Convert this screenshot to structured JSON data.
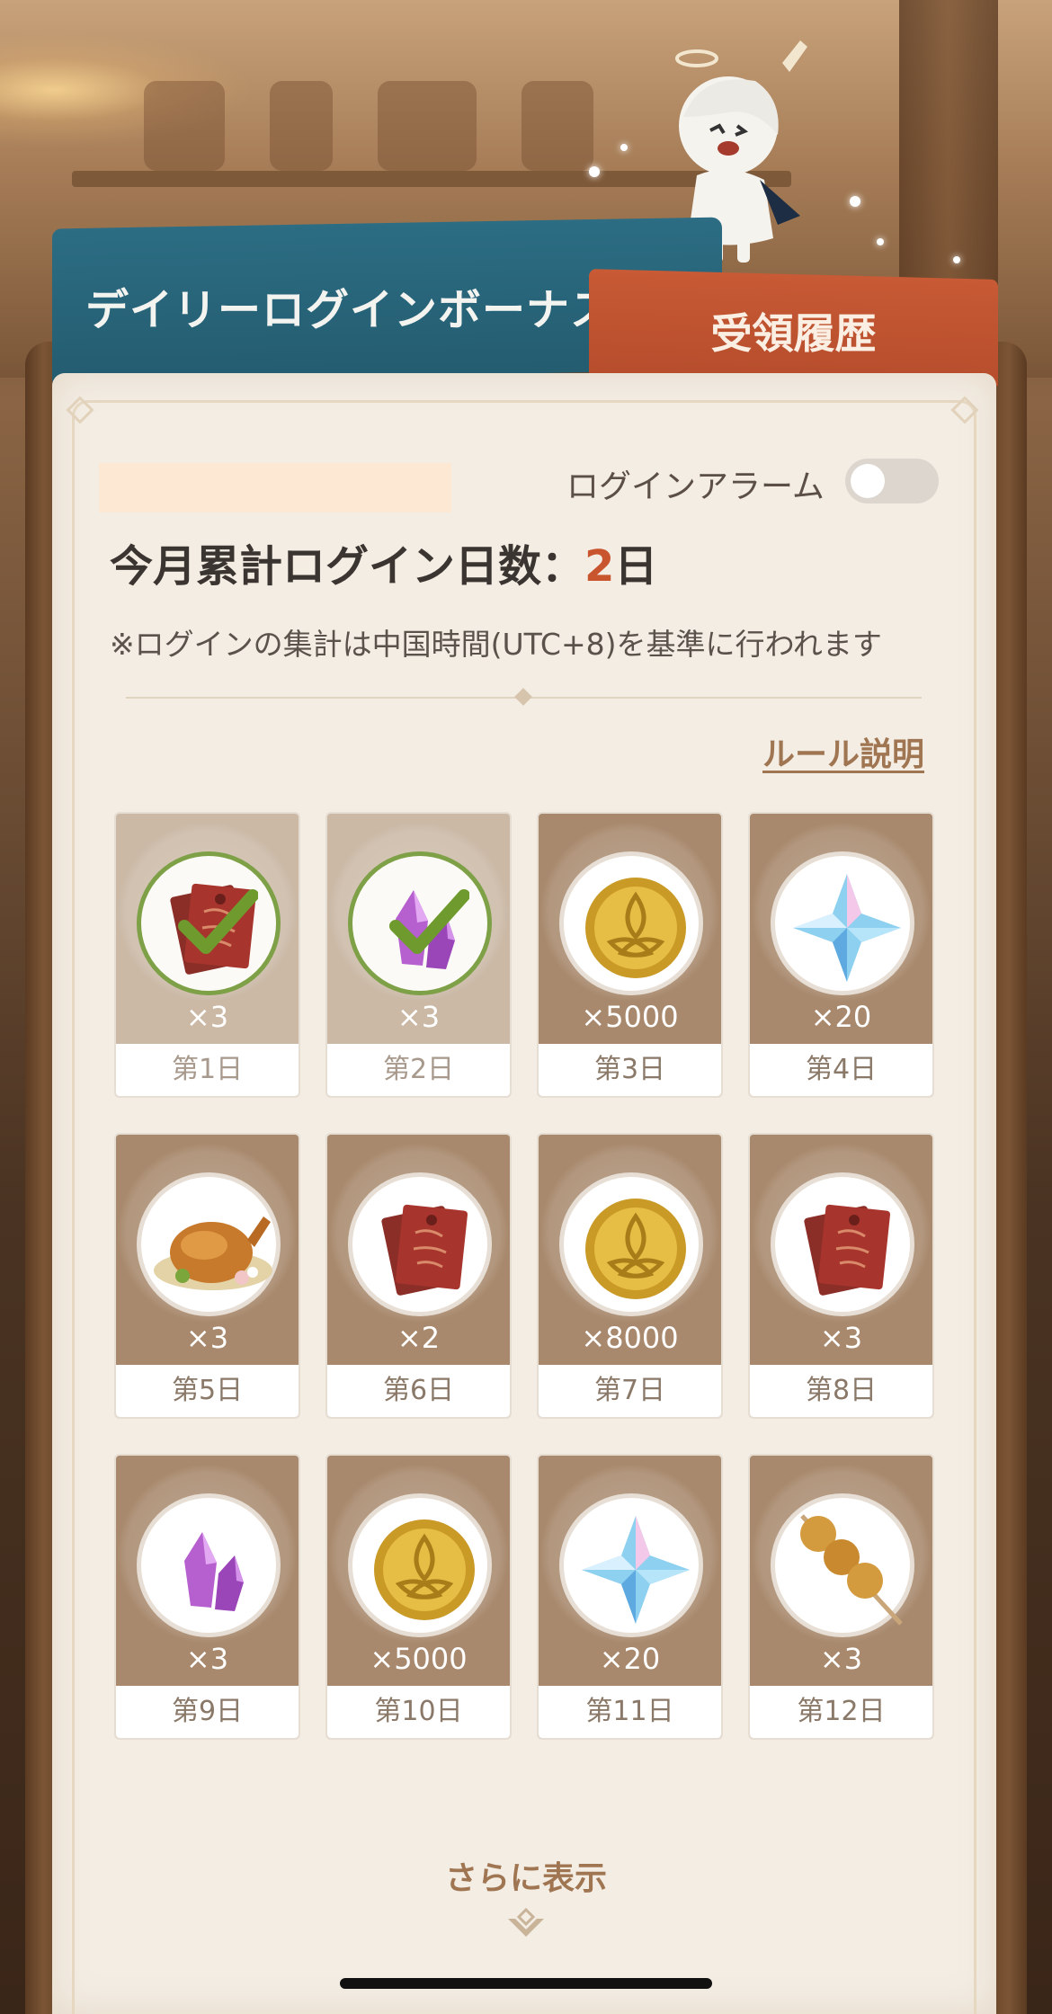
{
  "tabs": {
    "daily_login_bonus": "デイリーログインボーナス",
    "claim_history": "受領履歴"
  },
  "header": {
    "uid": "",
    "alarm_label": "ログインアラーム",
    "alarm_on": false,
    "login_count_prefix": "今月累計ログイン日数：",
    "login_count_value": "2",
    "login_count_suffix": "日",
    "notice": "※ログインの集計は中国時間(UTC+8)を基準に行われます",
    "rules_link": "ルール説明"
  },
  "rewards": [
    {
      "day": "第1日",
      "qty": "×3",
      "icon": "hero-wit-book-icon",
      "claimed": true
    },
    {
      "day": "第2日",
      "qty": "×3",
      "icon": "mystic-crystal-icon",
      "claimed": true
    },
    {
      "day": "第3日",
      "qty": "×5000",
      "icon": "mora-coin-icon",
      "claimed": false
    },
    {
      "day": "第4日",
      "qty": "×20",
      "icon": "primogem-icon",
      "claimed": false
    },
    {
      "day": "第5日",
      "qty": "×3",
      "icon": "roast-chicken-icon",
      "claimed": false
    },
    {
      "day": "第6日",
      "qty": "×2",
      "icon": "hero-wit-book-icon",
      "claimed": false
    },
    {
      "day": "第7日",
      "qty": "×8000",
      "icon": "mora-coin-icon",
      "claimed": false
    },
    {
      "day": "第8日",
      "qty": "×3",
      "icon": "hero-wit-book-icon",
      "claimed": false
    },
    {
      "day": "第9日",
      "qty": "×3",
      "icon": "mystic-crystal-icon",
      "claimed": false
    },
    {
      "day": "第10日",
      "qty": "×5000",
      "icon": "mora-coin-icon",
      "claimed": false
    },
    {
      "day": "第11日",
      "qty": "×20",
      "icon": "primogem-icon",
      "claimed": false
    },
    {
      "day": "第12日",
      "qty": "×3",
      "icon": "skewer-icon",
      "claimed": false
    }
  ],
  "footer": {
    "show_more": "さらに表示"
  },
  "colors": {
    "accent_orange": "#c9552f",
    "tab_blue": "#2c6d83",
    "tab_red": "#c85a35",
    "link_brown": "#a07652",
    "check_green": "#7ea046"
  }
}
